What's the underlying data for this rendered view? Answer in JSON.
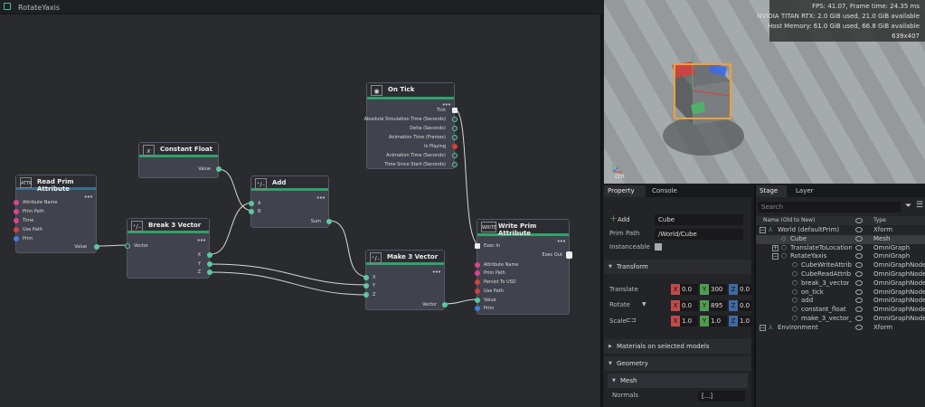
{
  "graph": {
    "tab_title": "RotateYaxis",
    "nodes": {
      "read_prim": {
        "title": "Read Prim Attribute",
        "icon": "ATTR",
        "pins": [
          "Attribute Name",
          "Prim Path",
          "Time",
          "Use Path",
          "Prim"
        ],
        "out": "Value"
      },
      "constant_float": {
        "title": "Constant Float",
        "icon": "x",
        "out": "Value"
      },
      "break3": {
        "title": "Break 3 Vector",
        "in": "Vector",
        "outs": [
          "X",
          "Y",
          "Z"
        ]
      },
      "add": {
        "title": "Add",
        "ins": [
          "A",
          "B"
        ],
        "out": "Sum"
      },
      "on_tick": {
        "title": "On Tick",
        "outs": [
          "Tick",
          "Absolute Simulation Time (Seconds)",
          "Delta (Seconds)",
          "Animation Time (Frames)",
          "Is Playing",
          "Animation Time (Seconds)",
          "Time Since Start (Seconds)"
        ]
      },
      "make3": {
        "title": "Make 3 Vector",
        "ins": [
          "X",
          "Y",
          "Z"
        ],
        "out": "Vector"
      },
      "write_prim": {
        "title": "Write Prim Attribute",
        "icon": "WRITE",
        "pins": [
          "Exec In",
          "Attribute Name",
          "Prim Path",
          "Persist To USD",
          "Use Path",
          "Value",
          "Prim"
        ],
        "out": "Exec Out"
      }
    },
    "menu_dots": "•••"
  },
  "viewport": {
    "stats": [
      "FPS: 41.07, Frame time: 24.35 ms",
      "NVIDIA TITAN RTX: 2.0 GiB used, 21.0 GiB available",
      "Host Memory: 61.0 GiB used, 66.8 GiB available",
      "639x407"
    ],
    "unit": "cm"
  },
  "property": {
    "tabs": [
      "Property",
      "Console"
    ],
    "add_label": "Add",
    "name_value": "Cube",
    "prim_path_label": "Prim Path",
    "prim_path_value": "/World/Cube",
    "instanceable_label": "Instanceable",
    "transform_label": "Transform",
    "translate_label": "Translate",
    "rotate_label": "Rotate",
    "scale_label": "Scale",
    "translate": [
      "0.0",
      "300",
      "0.0"
    ],
    "rotate": [
      "0.0",
      "895",
      "0.0"
    ],
    "scale": [
      "1.0",
      "1.0",
      "1.0"
    ],
    "materials_label": "Materials on selected models",
    "geometry_label": "Geometry",
    "mesh_label": "Mesh",
    "normals_label": "Normals",
    "normals_value": "[...]"
  },
  "stage": {
    "tabs": [
      "Stage",
      "Layer"
    ],
    "search_placeholder": "Search",
    "col_name": "Name (Old to New)",
    "col_type": "Type",
    "rows": [
      {
        "name": "World (defaultPrim)",
        "type": "Xform"
      },
      {
        "name": "Cube",
        "type": "Mesh"
      },
      {
        "name": "TranslateToLocation",
        "type": "OmniGraph"
      },
      {
        "name": "RotateYaxis",
        "type": "OmniGraph"
      },
      {
        "name": "CubeWriteAttrib",
        "type": "OmniGraphNode"
      },
      {
        "name": "CubeReadAttrib",
        "type": "OmniGraphNode"
      },
      {
        "name": "break_3_vector",
        "type": "OmniGraphNode"
      },
      {
        "name": "on_tick",
        "type": "OmniGraphNode"
      },
      {
        "name": "add",
        "type": "OmniGraphNode"
      },
      {
        "name": "constant_float",
        "type": "OmniGraphNode"
      },
      {
        "name": "make_3_vector_0",
        "type": "OmniGraphNode"
      },
      {
        "name": "Environment",
        "type": "Xform"
      }
    ]
  }
}
